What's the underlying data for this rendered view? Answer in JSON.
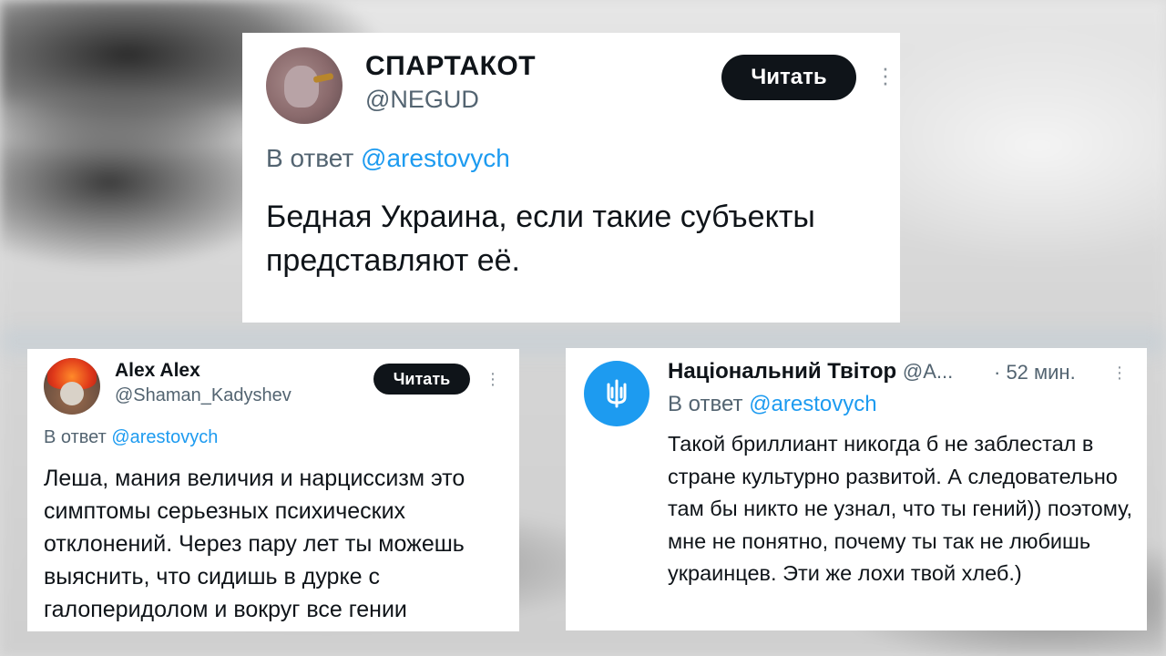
{
  "tweet_main": {
    "name": "СПАРТАКОТ",
    "handle": "@NEGUD",
    "read_label": "Читать",
    "reply_prefix": "В ответ",
    "reply_to": "@arestovych",
    "text": "Бедная Украина, если такие субъекты представляют её."
  },
  "tweet_alex": {
    "name": "Alex Alex",
    "handle": "@Shaman_Kadyshev",
    "read_label": "Читать",
    "reply_prefix": "В ответ",
    "reply_to": "@arestovych",
    "text": "Леша, мания величия и нарциссизм это симптомы серьезных психических отклонений. Через пару лет ты можешь выяснить, что сидишь в дурке с галоперидолом и вокруг все гении"
  },
  "tweet_nt": {
    "name": "Національний Твітор",
    "handle": "@A...",
    "time": "· 52 мин.",
    "reply_prefix": "В ответ",
    "reply_to": "@arestovych",
    "text": "Такой бриллиант никогда б не заблестал в стране культурно развитой. А следовательно там бы никто не узнал, что ты гений)) поэтому, мне не понятно, почему ты так не любишь украинцев. Эти же лохи твой хлеб.)"
  },
  "icons": {
    "more": "more-vertical-icon",
    "trident": "trident-icon"
  },
  "colors": {
    "accent": "#1d9bf0",
    "button": "#0f1419",
    "muted": "#536471"
  }
}
